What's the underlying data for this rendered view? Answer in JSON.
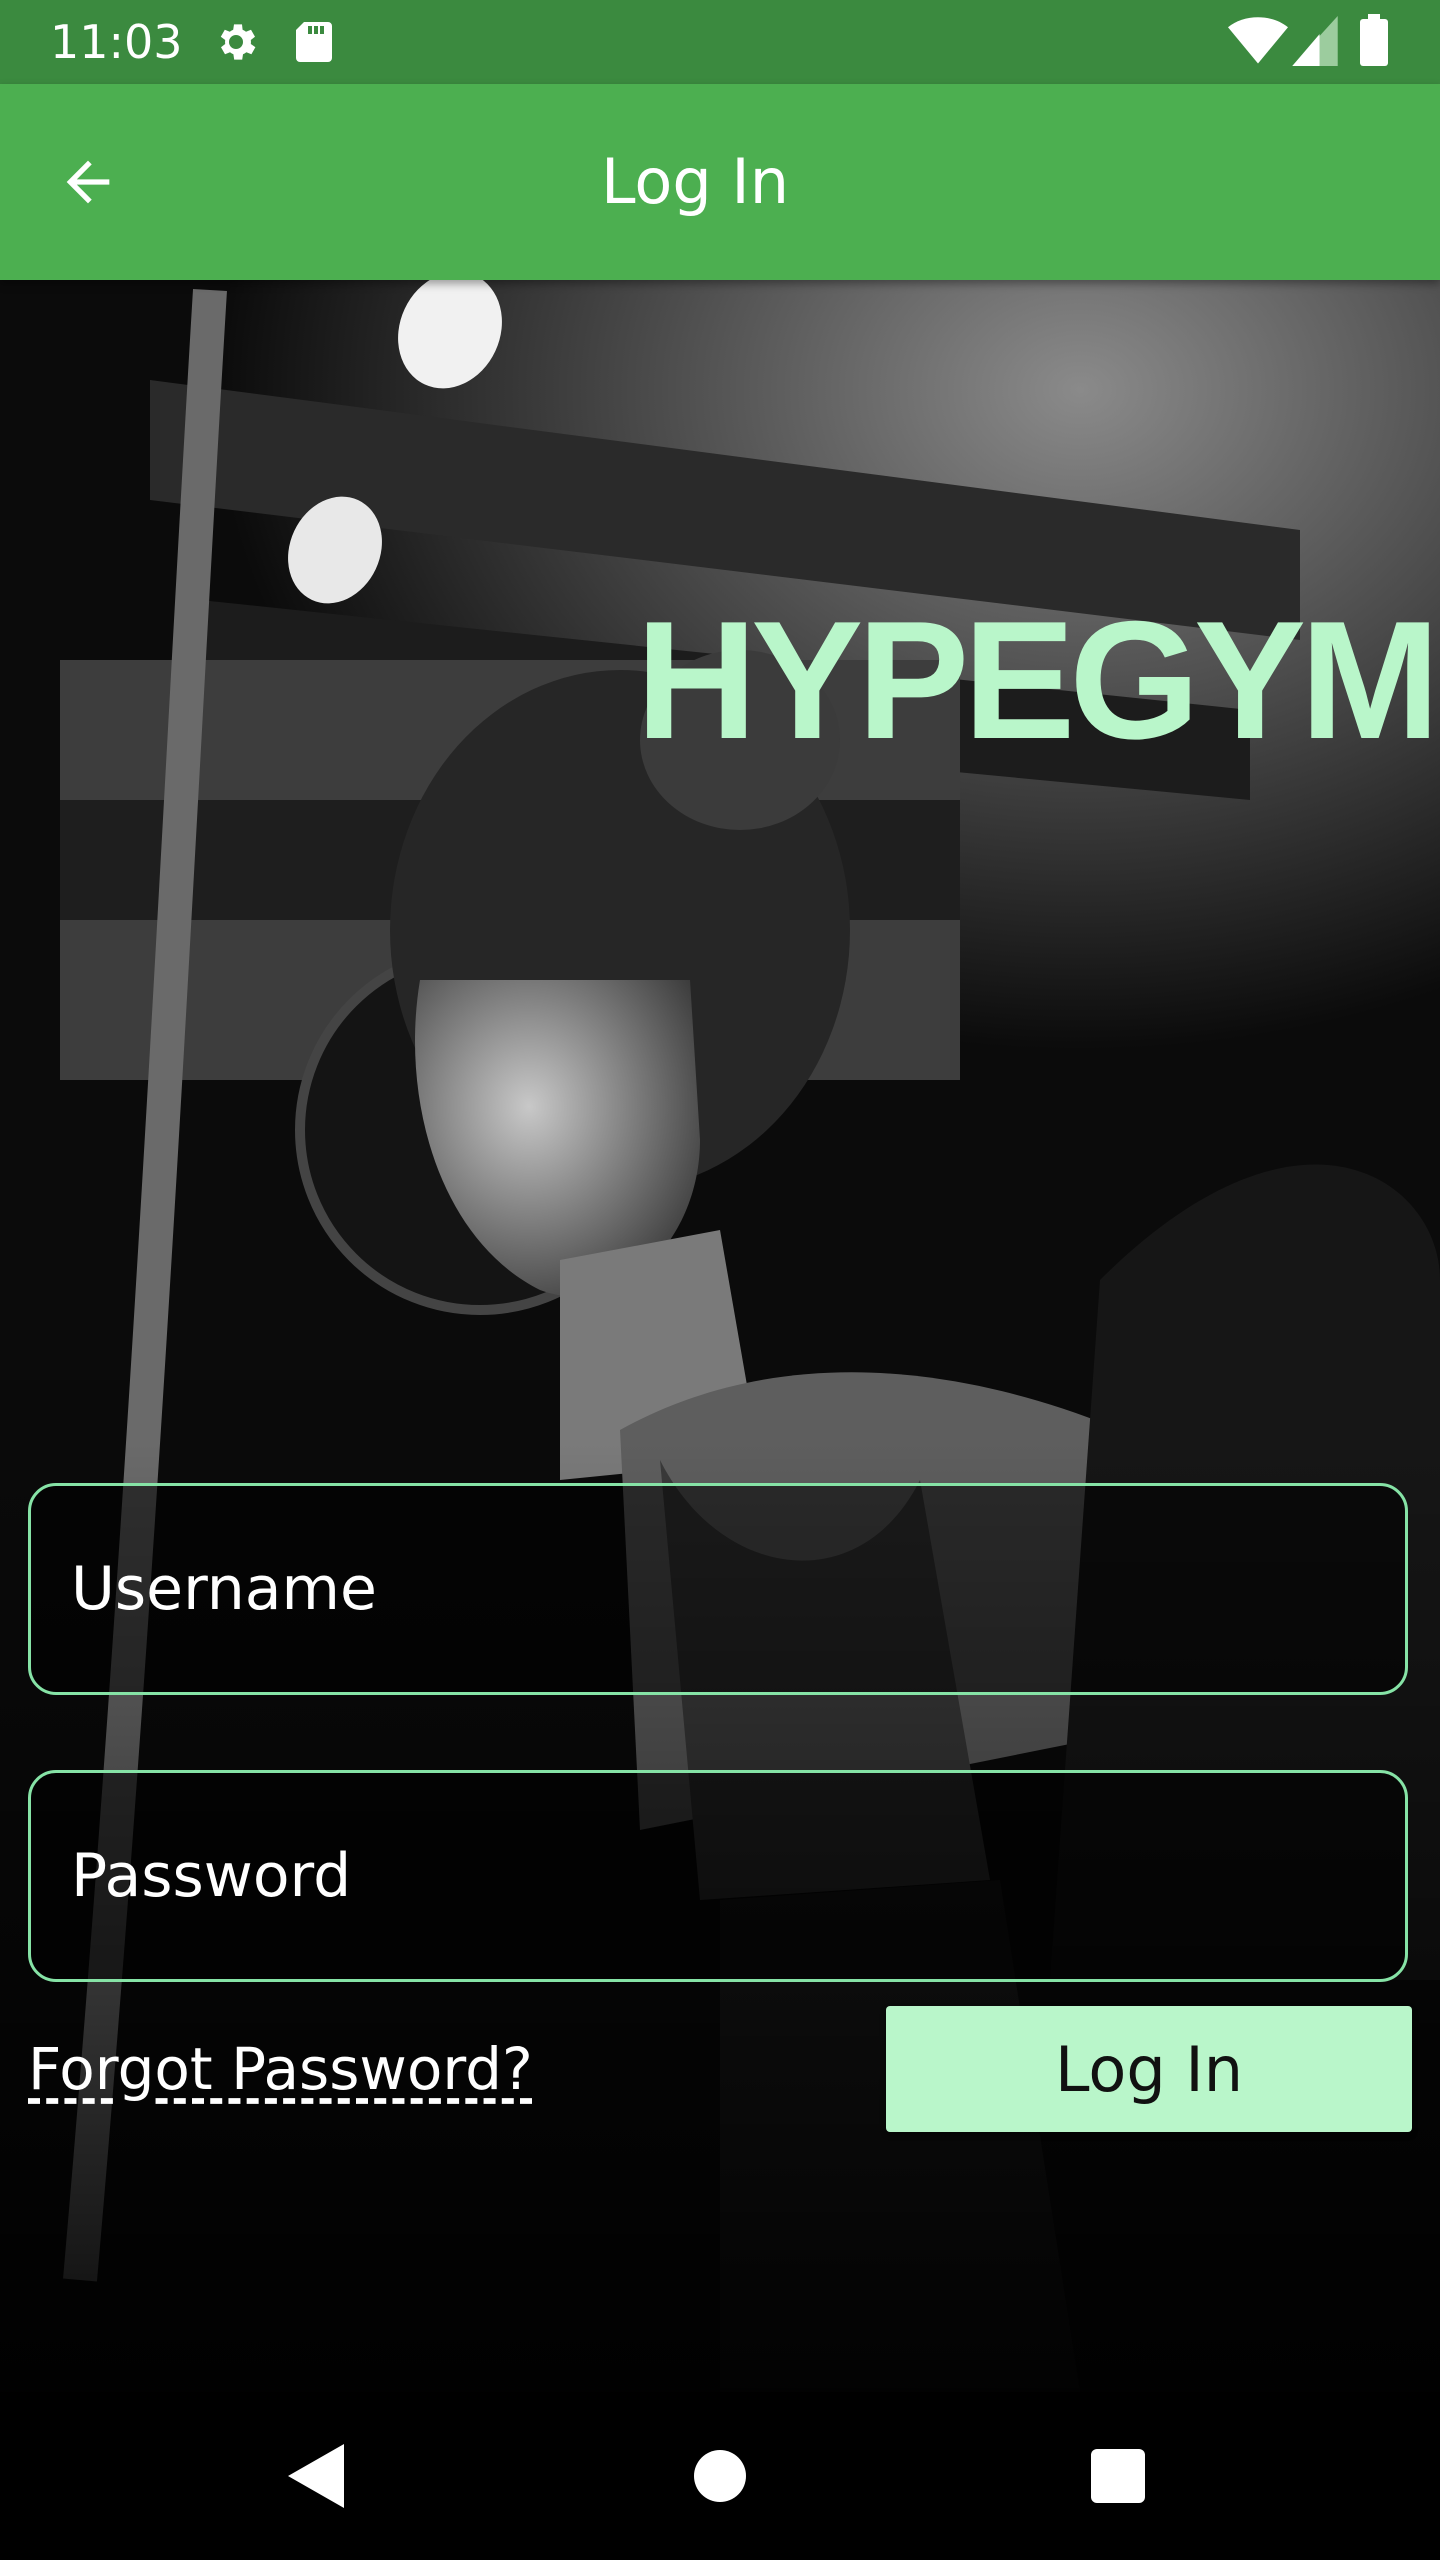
{
  "status_bar": {
    "time": "11:03",
    "icons": [
      "gear-icon",
      "sd-card-icon",
      "wifi-icon",
      "signal-icon",
      "battery-icon"
    ]
  },
  "app_bar": {
    "title": "Log In",
    "back_icon": "arrow-back-icon"
  },
  "hero": {
    "brand": "HYPEGYM"
  },
  "form": {
    "username_placeholder": "Username",
    "password_placeholder": "Password",
    "forgot_password": "Forgot Password?",
    "login_label": "Log In"
  },
  "nav_bar": {
    "icons": [
      "back-triangle-icon",
      "home-circle-icon",
      "recents-square-icon"
    ]
  },
  "colors": {
    "status_bar": "#3b8a3f",
    "app_bar": "#4caf50",
    "accent": "#b9f6ca",
    "field_border": "#86e3a6"
  }
}
